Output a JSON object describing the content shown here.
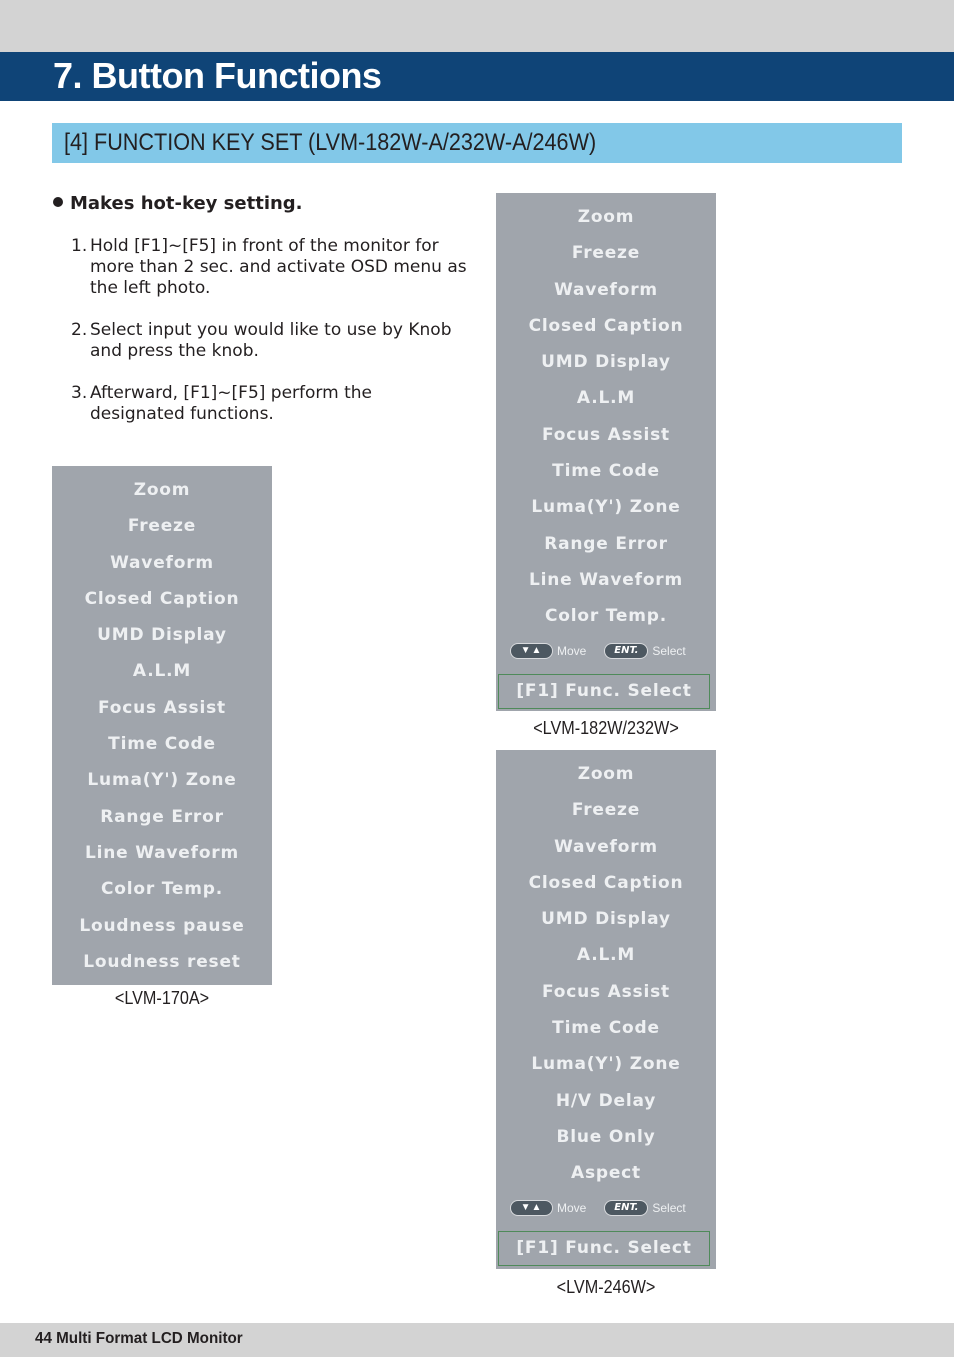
{
  "header": {
    "title": "7. Button Functions",
    "section": "[4] FUNCTION KEY SET (LVM-182W-A/232W-A/246W)"
  },
  "intro": {
    "bullet": "Makes hot-key setting.",
    "steps": [
      {
        "num": "1.",
        "text": "Hold [F1]~[F5] in front of the monitor for more than 2 sec. and activate OSD menu as the left photo."
      },
      {
        "num": "2.",
        "text": "Select input you would like to use by Knob and press the knob."
      },
      {
        "num": "3.",
        "text": "Afterward, [F1]~[F5] perform the designated functions."
      }
    ]
  },
  "menus": {
    "lvm170a": {
      "caption": "<LVM-170A>",
      "items": [
        "Zoom",
        "Freeze",
        "Waveform",
        "Closed Caption",
        "UMD Display",
        "A.L.M",
        "Focus Assist",
        "Time Code",
        "Luma(Y') Zone",
        "Range Error",
        "Line Waveform",
        "Color Temp.",
        "Loudness pause",
        "Loudness reset"
      ]
    },
    "lvm182w": {
      "caption": "<LVM-182W/232W>",
      "items": [
        "Zoom",
        "Freeze",
        "Waveform",
        "Closed Caption",
        "UMD Display",
        "A.L.M",
        "Focus Assist",
        "Time Code",
        "Luma(Y') Zone",
        "Range Error",
        "Line Waveform",
        "Color Temp."
      ],
      "hint": {
        "arrows_glyph": "▼▲",
        "move_label": "Move",
        "ent_glyph": "ENT.",
        "select_label": "Select"
      },
      "func_select": "[F1] Func. Select"
    },
    "lvm246w": {
      "caption": "<LVM-246W>",
      "items": [
        "Zoom",
        "Freeze",
        "Waveform",
        "Closed Caption",
        "UMD Display",
        "A.L.M",
        "Focus Assist",
        "Time Code",
        "Luma(Y') Zone",
        "H/V Delay",
        "Blue Only",
        "Aspect"
      ],
      "hint": {
        "arrows_glyph": "▼▲",
        "move_label": "Move",
        "ent_glyph": "ENT.",
        "select_label": "Select"
      },
      "func_select": "[F1] Func. Select"
    }
  },
  "footer": {
    "text": "44  Multi Format LCD Monitor"
  }
}
